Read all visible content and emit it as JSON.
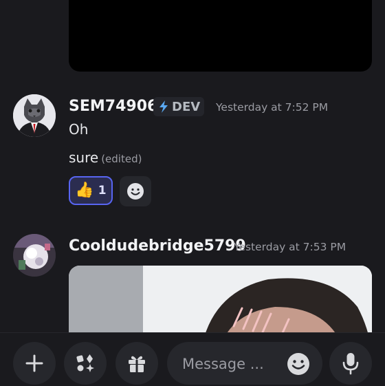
{
  "messages": [
    {
      "author": "SEM74906",
      "badge": "DEV",
      "timestamp": "Yesterday at 7:52 PM",
      "lines": [
        {
          "text": "Oh"
        },
        {
          "text": "sure",
          "edited": "(edited)"
        }
      ],
      "reactions": [
        {
          "emoji": "👍",
          "count": "1",
          "icon": "thumbs-up"
        }
      ]
    },
    {
      "author": "Cooldudebridge5799",
      "timestamp": "Yesterday at 7:53 PM",
      "attachment": "gif-image"
    }
  ],
  "composer": {
    "placeholder": "Message ...",
    "icons": [
      "plus-icon",
      "apps-icon",
      "gift-icon",
      "emoji-icon",
      "microphone-icon"
    ]
  },
  "colors": {
    "background": "#1a1a1e",
    "surface": "#26272c",
    "accent": "#5865f2",
    "muted_text": "#9b9ca3"
  }
}
